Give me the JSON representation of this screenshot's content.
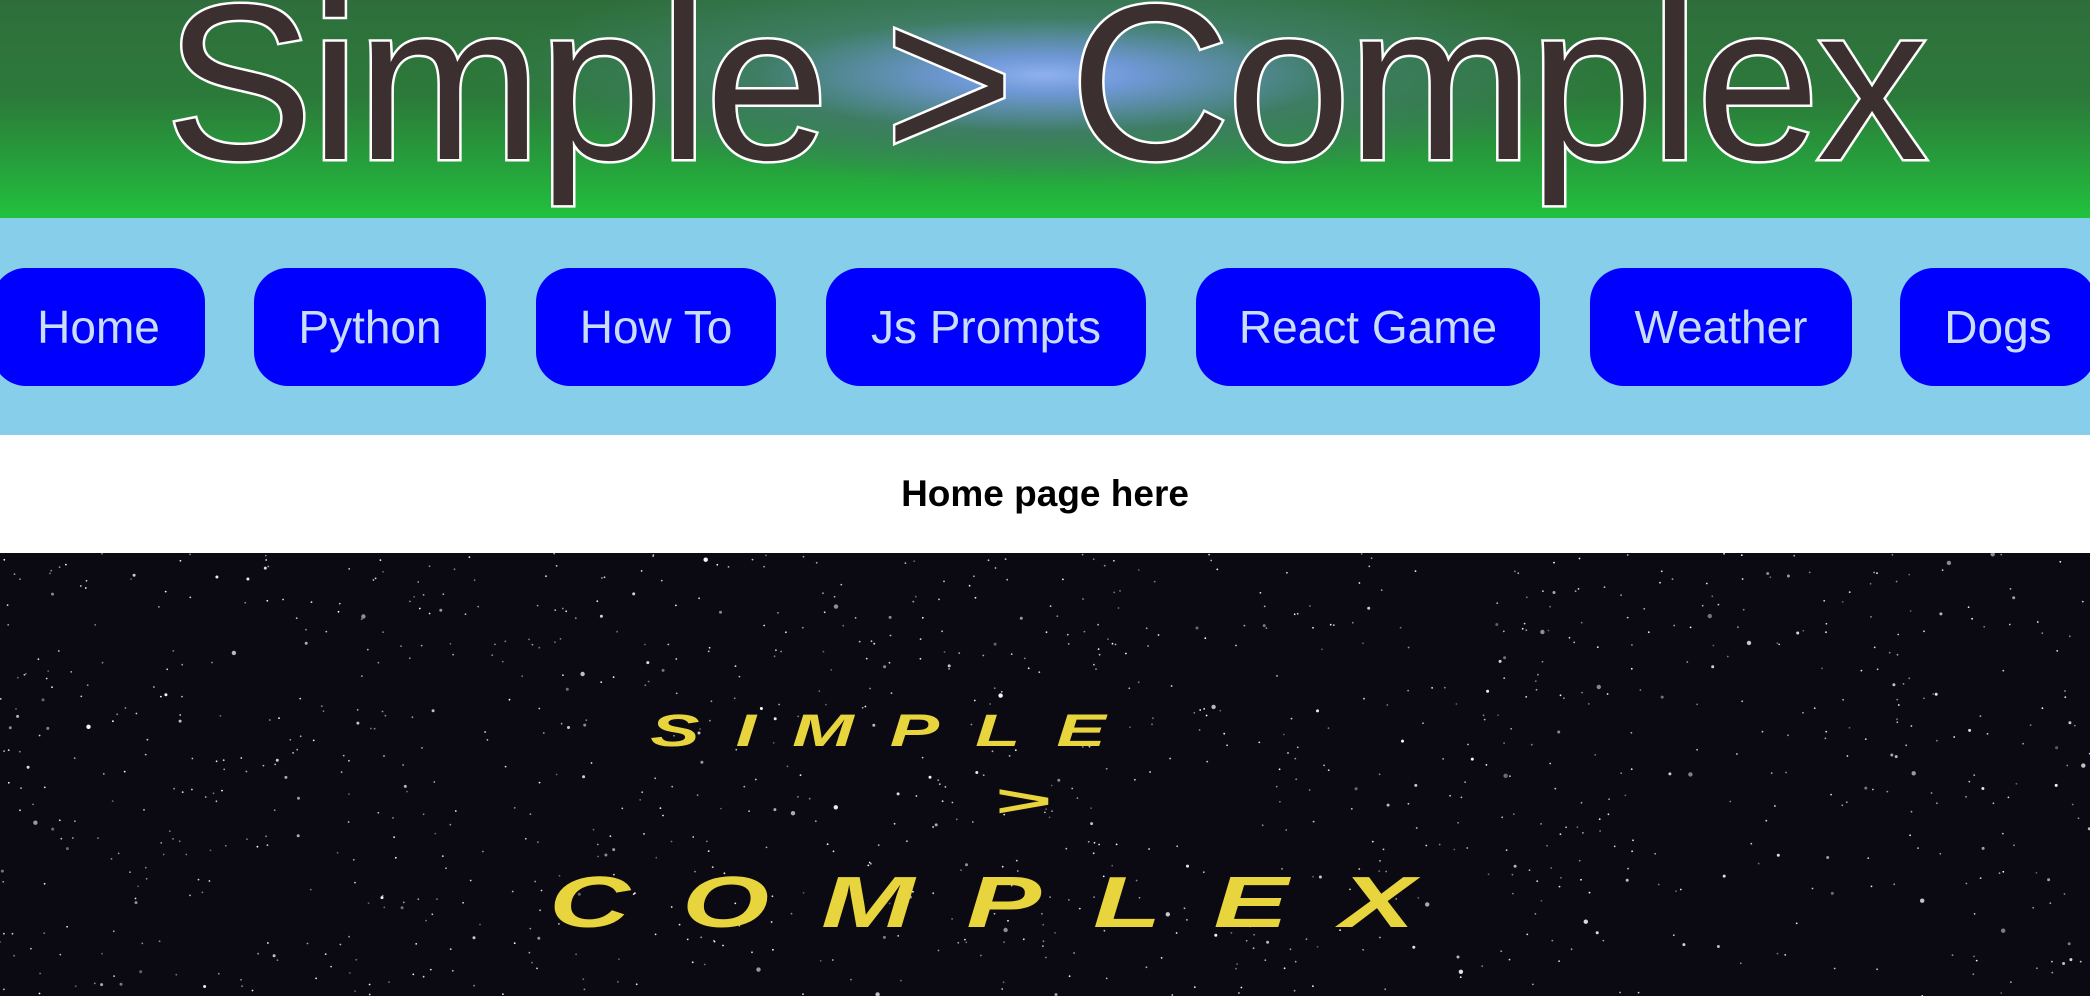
{
  "header": {
    "title": "Simple > Complex"
  },
  "nav": {
    "items": [
      {
        "label": "Home"
      },
      {
        "label": "Python"
      },
      {
        "label": "How To"
      },
      {
        "label": "Js Prompts"
      },
      {
        "label": "React Game"
      },
      {
        "label": "Weather"
      },
      {
        "label": "Dogs"
      }
    ]
  },
  "main": {
    "home_text": "Home page here"
  },
  "crawl": {
    "line1": "SIMPLE",
    "line2": ">",
    "line3": "COMPLEX"
  },
  "colors": {
    "header_green": "#2c7a3a",
    "header_glow": "#8fb0ee",
    "title_fill": "#3b2f2f",
    "nav_background": "#87ceeb",
    "nav_button": "#0000ff",
    "nav_text": "#c9ddf7",
    "space_background": "#0b0a12",
    "crawl_yellow": "#e8d43c"
  }
}
